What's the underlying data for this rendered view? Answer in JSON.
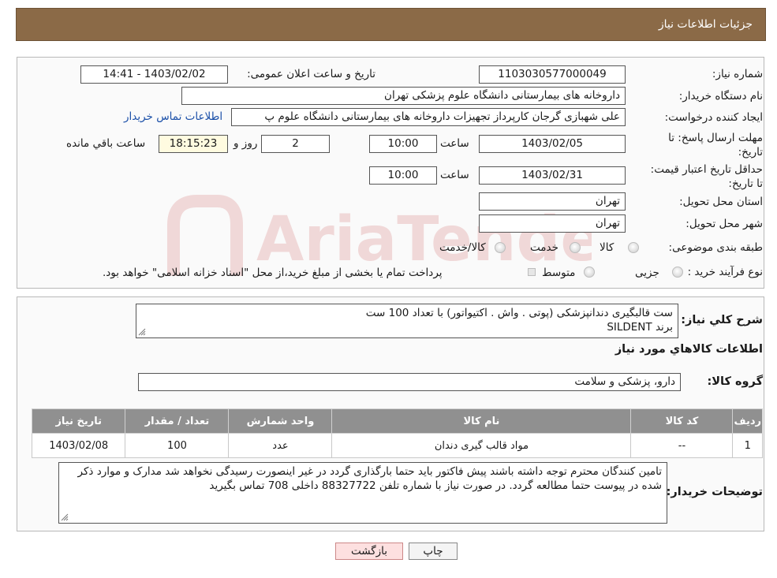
{
  "header": {
    "title": "جزئیات اطلاعات نیاز"
  },
  "form": {
    "need_number_label": "شماره نیاز:",
    "need_number": "1103030577000049",
    "announce_label": "تاریخ و ساعت اعلان عمومی:",
    "announce_value": "1403/02/02 - 14:41",
    "buyer_org_label": "نام دستگاه خریدار:",
    "buyer_org": "داروخانه های بیمارستانی دانشگاه علوم پزشکی تهران",
    "creator_label": "ایجاد کننده درخواست:",
    "creator": "علی شهبازی گرجان کارپرداز تجهیزات داروخانه های بیمارستانی دانشگاه علوم پ",
    "contact_link": "اطلاعات تماس خریدار",
    "deadline_label": "مهلت ارسال پاسخ: تا تاریخ:",
    "deadline_date": "1403/02/05",
    "time_label": "ساعت",
    "deadline_time": "10:00",
    "days": "2",
    "days_label": "روز و",
    "remaining": "18:15:23",
    "remaining_label": "ساعت باقي مانده",
    "validity_label": "حداقل تاریخ اعتبار قیمت: تا تاریخ:",
    "validity_date": "1403/02/31",
    "validity_time": "10:00",
    "province_label": "استان محل تحویل:",
    "province": "تهران",
    "city_label": "شهر محل تحویل:",
    "city": "تهران",
    "category_label": "طبقه بندی موضوعی:",
    "category_options": [
      "کالا",
      "خدمت",
      "کالا/خدمت"
    ],
    "process_label": "نوع فرآیند خرید :",
    "process_options": [
      "جزیی",
      "متوسط"
    ],
    "process_note": "پرداخت تمام یا بخشی از مبلغ خرید،از محل \"اسناد خزانه اسلامی\" خواهد بود."
  },
  "details": {
    "summary_label": "شرح کلي نياز:",
    "summary_line1": "ست قالبگیری دندانپزشکی (پوتی . واش . اکتیواتور) با تعداد 100 ست",
    "summary_line2": "برند SILDENT",
    "items_heading": "اطلاعات کالاهاي مورد نياز",
    "group_label": "گروه کالا:",
    "group_value": "دارو، پزشکی و سلامت",
    "table": {
      "headers": [
        "ردیف",
        "کد کالا",
        "نام کالا",
        "واحد شمارش",
        "تعداد / مقدار",
        "تاریخ نیاز"
      ],
      "rows": [
        [
          "1",
          "--",
          "مواد قالب گیری دندان",
          "عدد",
          "100",
          "1403/02/08"
        ]
      ]
    },
    "buyer_notes_label": "توضیحات خریدار:",
    "buyer_notes": "تامین کنندگان محترم توجه داشته باشند پیش فاکتور باید حتما بارگذاری گردد در غیر اینصورت رسیدگی نخواهد شد مدارک و موارد ذکر شده در پیوست حتما مطالعه گردد. در صورت نیاز با شماره تلفن 88327722 داخلی 708 تماس بگیرید"
  },
  "buttons": {
    "print": "چاپ",
    "back": "بازگشت"
  },
  "watermark": {
    "text": "AriaTender.neT"
  },
  "colors": {
    "header_bg": "#8b6a47",
    "table_header_bg": "#909090",
    "back_button_bg": "#fde0e0",
    "link": "#1a4fa8",
    "watermark": "#b00000"
  }
}
